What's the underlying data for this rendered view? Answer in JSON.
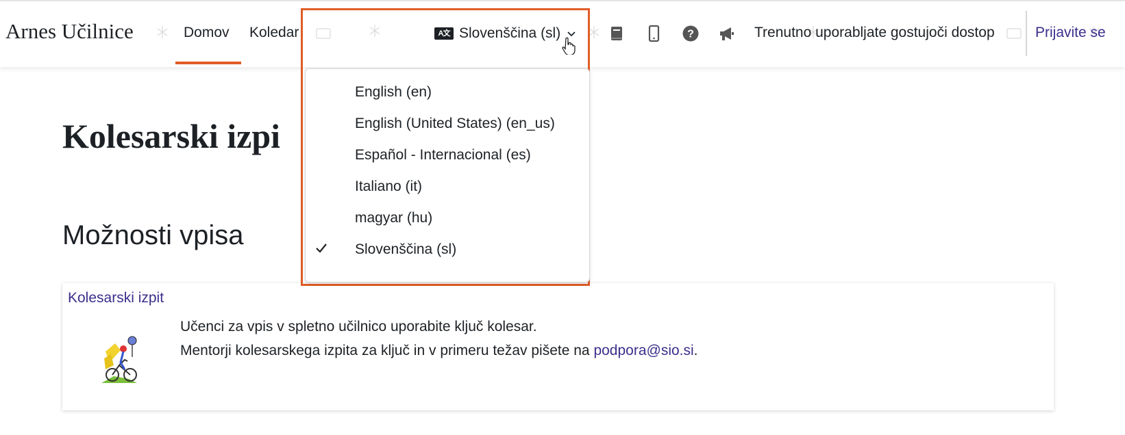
{
  "header": {
    "brand": "Arnes Učilnice",
    "nav": [
      {
        "label": "Domov",
        "active": true
      },
      {
        "label": "Koledar",
        "active": false
      }
    ],
    "language_trigger": {
      "icon": "language-icon",
      "label": "Slovenščina (sl)"
    },
    "icons": [
      "book-icon",
      "mobile-icon",
      "help-icon",
      "megaphone-icon"
    ],
    "guest_text": "Trenutno uporabljate gostujoči dostop",
    "login_label": "Prijavite se"
  },
  "language_menu": {
    "items": [
      {
        "label": "English (en)",
        "selected": false
      },
      {
        "label": "English (United States) (en_us)",
        "selected": false
      },
      {
        "label": "Español - Internacional (es)",
        "selected": false
      },
      {
        "label": "Italiano (it)",
        "selected": false
      },
      {
        "label": "magyar (hu)",
        "selected": false
      },
      {
        "label": "Slovenščina (sl)",
        "selected": true
      }
    ]
  },
  "main": {
    "page_title": "Kolesarski izpi",
    "section_title": "Možnosti vpisa",
    "enrolment": {
      "title": "Kolesarski izpit",
      "line1": "Učenci za vpis v spletno učilnico uporabite ključ kolesar.",
      "line2_text": "Mentorji kolesarskega izpita za ključ in v primeru težav pišete na ",
      "email": "podpora@sio.si",
      "line2_end": "."
    }
  },
  "colors": {
    "accent": "#e05c26",
    "link": "#3a2f8c",
    "text": "#1d2125"
  }
}
